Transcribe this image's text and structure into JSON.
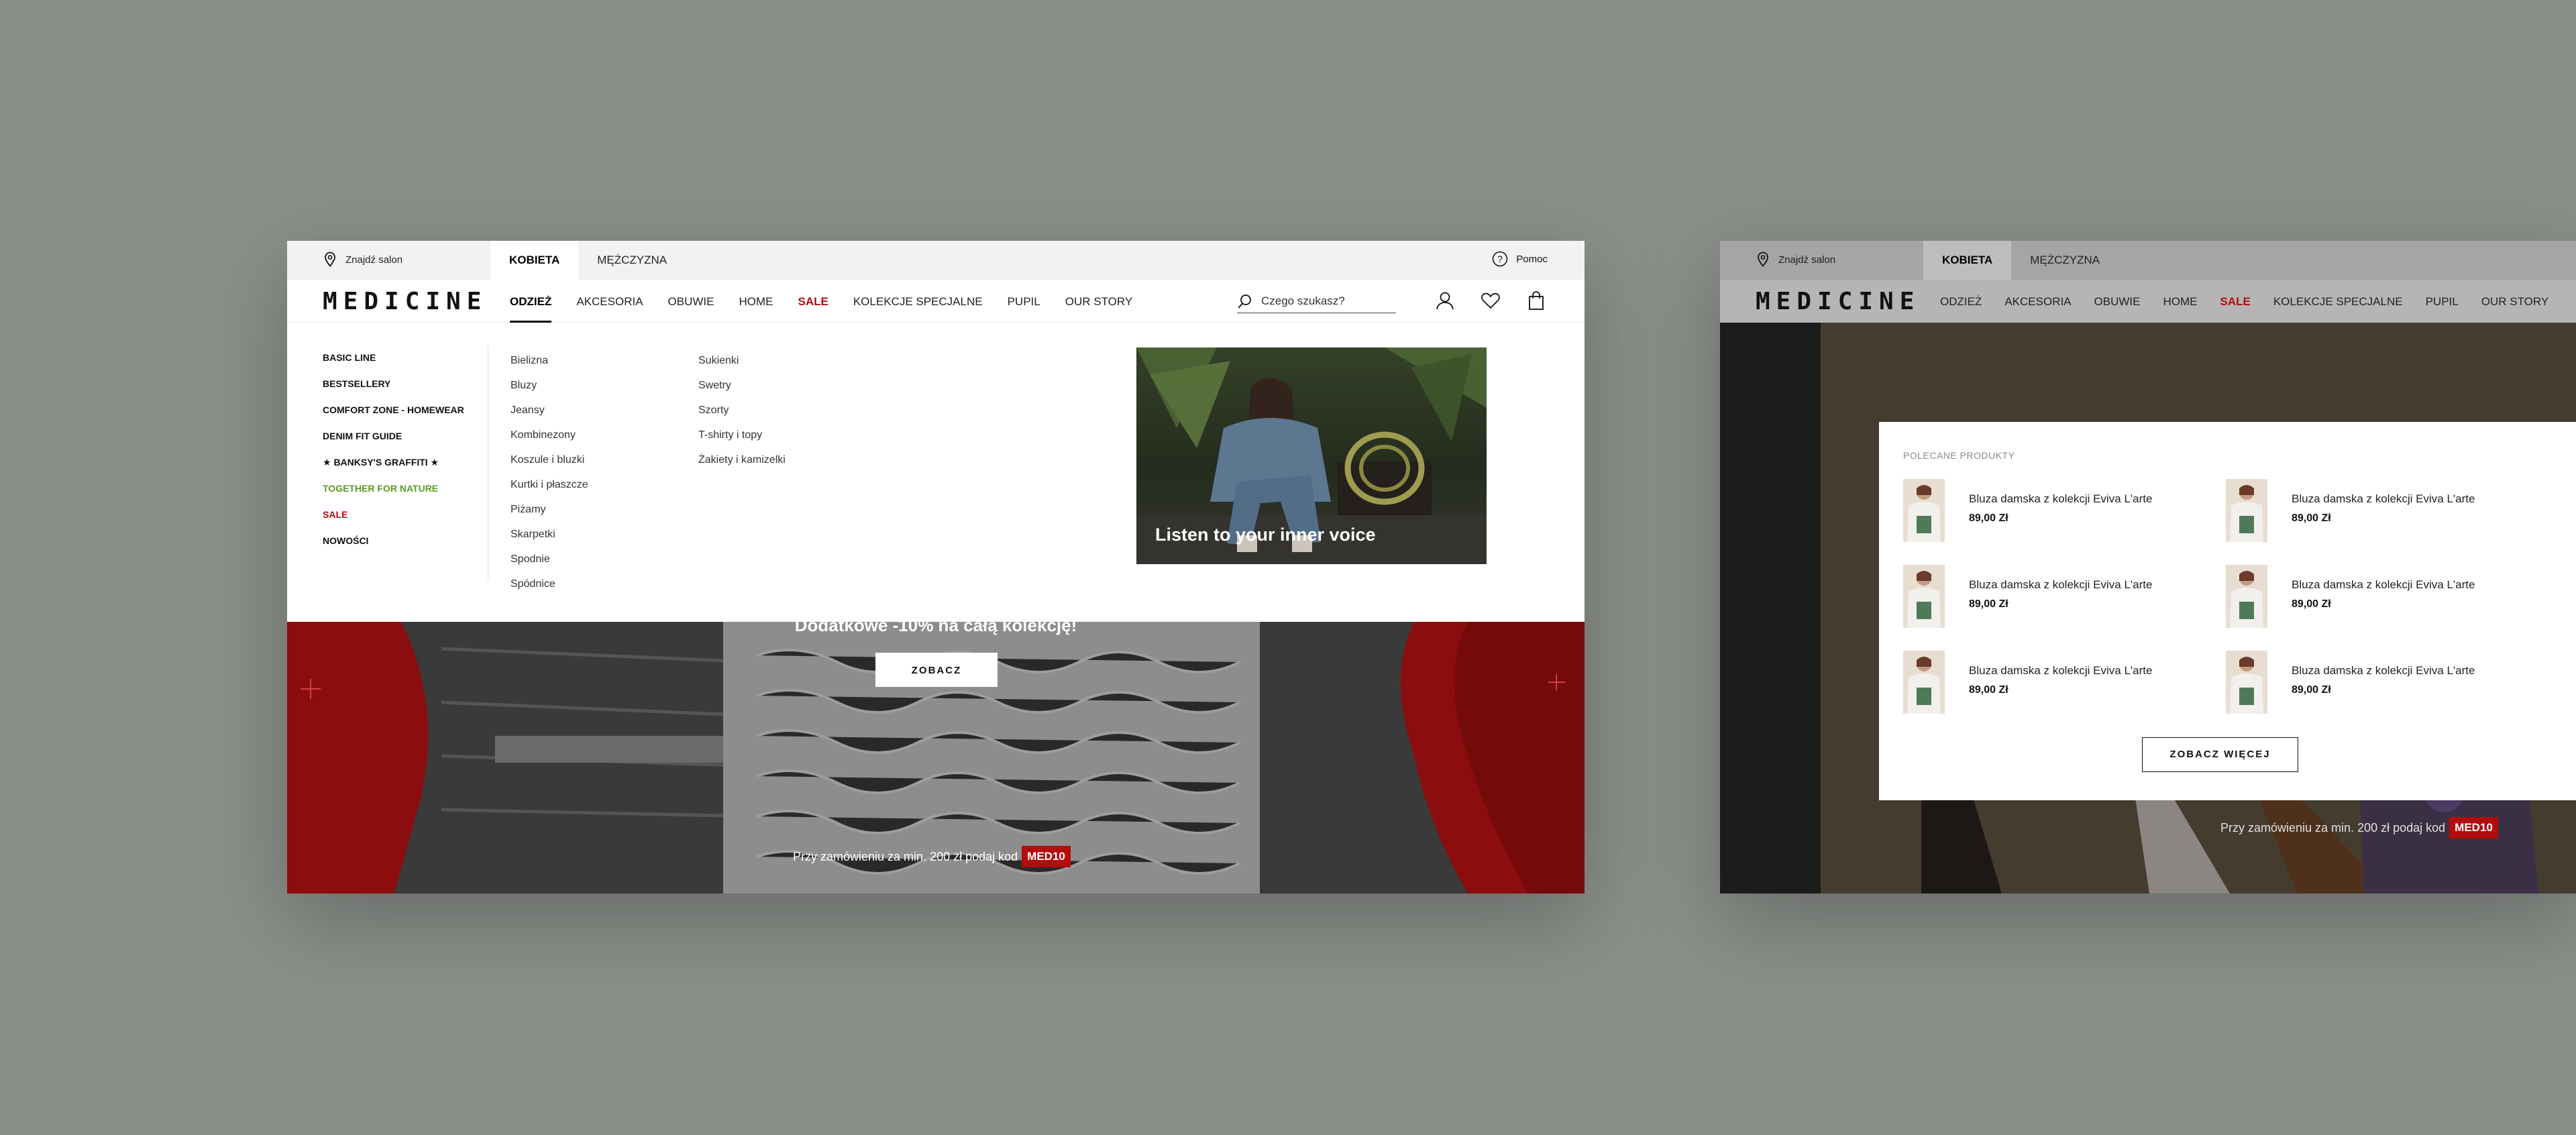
{
  "colors": {
    "background": "#8b8f8a",
    "accent_red": "#b20c0c",
    "green": "#5a9a22"
  },
  "mock1": {
    "topbar": {
      "find_salon": "Znajdź salon",
      "tabs": [
        "KOBIETA",
        "MĘŻCZYZNA"
      ],
      "help": "Pomoc"
    },
    "logo": "MEDICINE",
    "nav": [
      "ODZIEŻ",
      "AKCESORIA",
      "OBUWIE",
      "HOME",
      "SALE",
      "KOLEKCJE SPECJALNE",
      "PUPIL",
      "OUR STORY"
    ],
    "search_placeholder": "Czego szukasz?",
    "icons": [
      "account-icon",
      "heart-icon",
      "bag-icon"
    ],
    "menu_col1": [
      "BASIC LINE",
      "BESTSELLERY",
      "COMFORT ZONE - HOMEWEAR",
      "DENIM FIT GUIDE",
      "★ BANKSY'S GRAFFITI ★",
      "TOGETHER FOR NATURE",
      "SALE",
      "NOWOŚCI"
    ],
    "menu_col2": [
      "Bielizna",
      "Bluzy",
      "Jeansy",
      "Kombinezony",
      "Koszule i bluzki",
      "Kurtki i płaszcze",
      "Piżamy",
      "Skarpetki",
      "Spodnie",
      "Spódnice"
    ],
    "menu_col3": [
      "Sukienki",
      "Swetry",
      "Szorty",
      "T-shirty i topy",
      "Żakiety i kamizelki"
    ],
    "banner_title": "Listen to your inner voice",
    "hero": {
      "headline": "Dodatkowe -10% na całą kolekcję!",
      "cta": "ZOBACZ",
      "promo": "Przy zamówieniu za min. 200 zł podaj kod",
      "code": "MED10"
    }
  },
  "mock2": {
    "topbar": {
      "find_salon": "Znajdź salon",
      "tabs": [
        "KOBIETA",
        "MĘŻCZYZNA"
      ]
    },
    "logo": "MEDICINE",
    "nav": [
      "ODZIEŻ",
      "AKCESORIA",
      "OBUWIE",
      "HOME",
      "SALE",
      "KOLEKCJE SPECJALNE",
      "PUPIL",
      "OUR STORY"
    ],
    "panel_heading": "POLECANE PRODUKTY",
    "products": [
      {
        "name": "Bluza damska z kolekcji Eviva L'arte",
        "price": "89,00 Zł"
      },
      {
        "name": "Bluza damska z kolekcji Eviva L'arte",
        "price": "89,00 Zł"
      },
      {
        "name": "Bluza damska z kolekcji Eviva L'arte",
        "price": "89,00 Zł"
      },
      {
        "name": "Bluza damska z kolekcji Eviva L'arte",
        "price": "89,00 Zł"
      },
      {
        "name": "Bluza damska z kolekcji Eviva L'arte",
        "price": "89,00 Zł"
      },
      {
        "name": "Bluza damska z kolekcji Eviva L'arte",
        "price": "89,00 Zł"
      }
    ],
    "more_button": "ZOBACZ WIĘCEJ",
    "promo": "Przy zamówieniu za min. 200 zł podaj kod",
    "code": "MED10"
  }
}
